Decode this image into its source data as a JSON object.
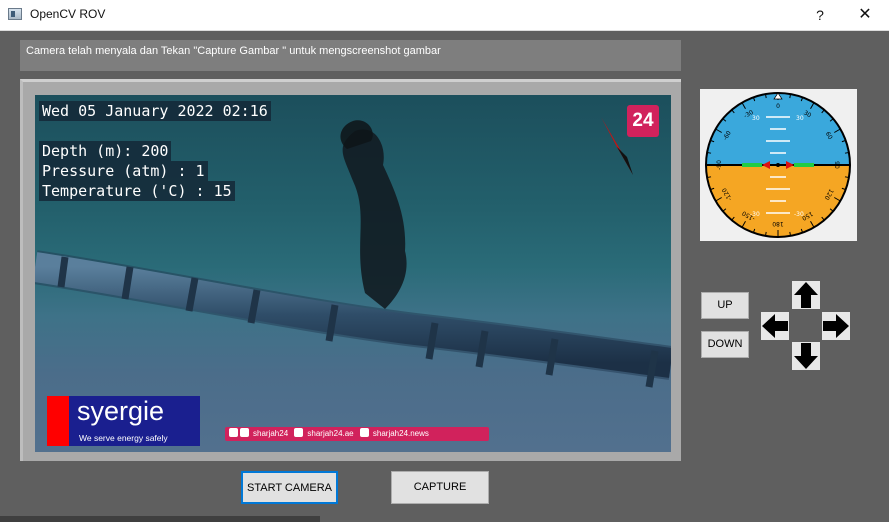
{
  "window": {
    "title": "OpenCV ROV",
    "help_label": "?",
    "close_label": "✕"
  },
  "status": {
    "message": "Camera telah menyala dan Tekan \"Capture Gambar \" untuk mengscreenshot gambar"
  },
  "video": {
    "datetime": "Wed 05 January 2022 02:16",
    "depth": "Depth (m): 200",
    "pressure": "Pressure (atm) : 1",
    "temperature": "Temperature ('C) : 15",
    "channel_logo": "24",
    "brand_name": "syergie",
    "brand_tagline": "We serve energy safely",
    "social": {
      "instagram_twitter": "sharjah24",
      "facebook": "sharjah24.ae",
      "youtube": "sharjah24.news"
    }
  },
  "attitude_indicator": {
    "sky_color": "#3aa8dc",
    "ground_color": "#f5a623",
    "pitch_labels": [
      "30",
      "30",
      "-30",
      "-30"
    ],
    "roll_labels": [
      "0",
      "30",
      "-30",
      "60",
      "-60",
      "90",
      "-90",
      "120",
      "-120",
      "150",
      "-150",
      "180"
    ]
  },
  "controls": {
    "up_label": "UP",
    "down_label": "DOWN",
    "arrows": [
      "arrow-up-icon",
      "arrow-left-icon",
      "arrow-right-icon",
      "arrow-down-icon"
    ]
  },
  "actions": {
    "start_camera_label": "START CAMERA",
    "capture_label": "CAPTURE"
  },
  "colors": {
    "background": "#5f5f5f",
    "accent_focus": "#0078d7",
    "brand_blue": "#1a1f8f",
    "brand_red": "#ff0000",
    "channel_pink": "#d1225c"
  }
}
